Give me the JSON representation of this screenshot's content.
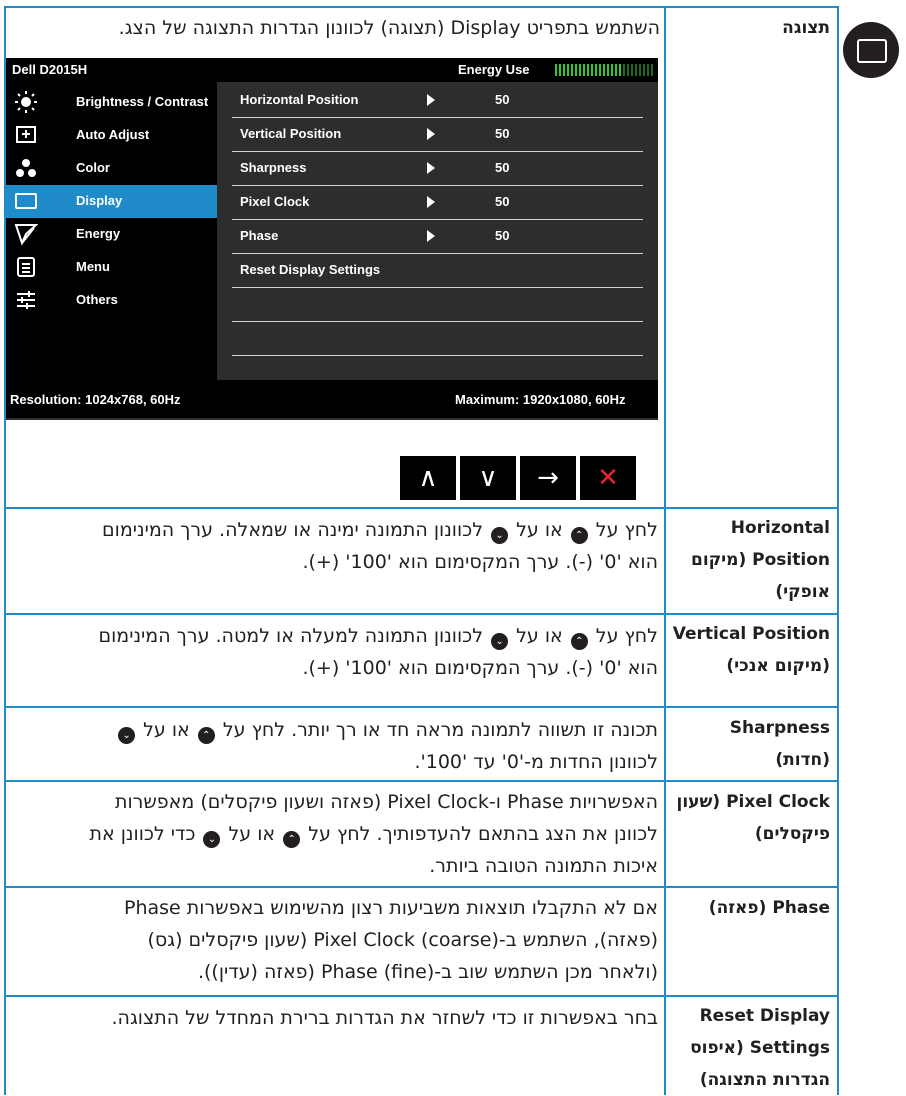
{
  "icon": {
    "name": "display-icon",
    "color": "#231f20"
  },
  "section": {
    "label": "תצוגה",
    "intro": "השתמש בתפריט Display (תצוגה) לכוונון הגדרות התצוגה של הצג."
  },
  "osd": {
    "model": "Dell D2015H",
    "energy_label": "Energy Use",
    "menu": [
      {
        "label": "Brightness / Contrast",
        "icon": "brightness-icon"
      },
      {
        "label": "Auto Adjust",
        "icon": "auto-adjust-icon"
      },
      {
        "label": "Color",
        "icon": "color-icon"
      },
      {
        "label": "Display",
        "icon": "display-icon",
        "selected": true
      },
      {
        "label": "Energy",
        "icon": "energy-icon"
      },
      {
        "label": "Menu",
        "icon": "menu-icon"
      },
      {
        "label": "Others",
        "icon": "others-icon"
      }
    ],
    "submenu": [
      {
        "label": "Horizontal Position",
        "value": "50"
      },
      {
        "label": "Vertical Position",
        "value": "50"
      },
      {
        "label": "Sharpness",
        "value": "50"
      },
      {
        "label": "Pixel Clock",
        "value": "50"
      },
      {
        "label": "Phase",
        "value": "50"
      },
      {
        "label": "Reset Display Settings",
        "value": ""
      }
    ],
    "resolution": "Resolution: 1024x768, 60Hz",
    "maximum": "Maximum: 1920x1080, 60Hz",
    "accent_color": "#1f8bc9",
    "exit_color": "#e3262a"
  },
  "buttons": {
    "up": "∧",
    "down": "∨",
    "enter": "→",
    "exit": "✕"
  },
  "rows": [
    {
      "name": "Horizontal Position (מיקום אופקי)",
      "lines": [
        "לחץ על [up] או על [down] לכוונון התמונה ימינה או שמאלה. ערך המינימום",
        "הוא '0' (-). ערך המקסימום הוא '100' (+)."
      ]
    },
    {
      "name": "Vertical Position (מיקום אנכי)",
      "lines": [
        "לחץ על [up] או על [down] לכוונון התמונה למעלה או למטה. ערך המינימום",
        "הוא '0' (-). ערך המקסימום הוא '100' (+)."
      ]
    },
    {
      "name": "Sharpness (חדות)",
      "lines": [
        "תכונה זו תשווה לתמונה מראה חד או רך יותר. לחץ על [up] או על [down]",
        "לכוונון החדות מ-'0' עד '100'."
      ]
    },
    {
      "name": "Pixel Clock (שעון פיקסלים)",
      "lines": [
        "האפשרויות Phase ו-Pixel Clock (פאזה ושעון פיקסלים) מאפשרות",
        "לכוונן את הצג בהתאם להעדפותיך. לחץ על [up] או על [down] כדי לכוונן את",
        "איכות התמונה הטובה ביותר."
      ]
    },
    {
      "name": "Phase (פאזה)",
      "lines": [
        "אם לא התקבלו תוצאות משביעות רצון מהשימוש באפשרות Phase",
        "(פאזה), השתמש ב-Pixel Clock (coarse) (שעון פיקסלים (גס)",
        "(ולאחר מכן השתמש שוב ב-Phase (fine) (פאזה (עדין))."
      ]
    },
    {
      "name": "Reset Display Settings (איפוס הגדרות התצוגה)",
      "lines": [
        "בחר באפשרות זו כדי לשחזר את הגדרות ברירת המחדל של התצוגה."
      ]
    }
  ]
}
